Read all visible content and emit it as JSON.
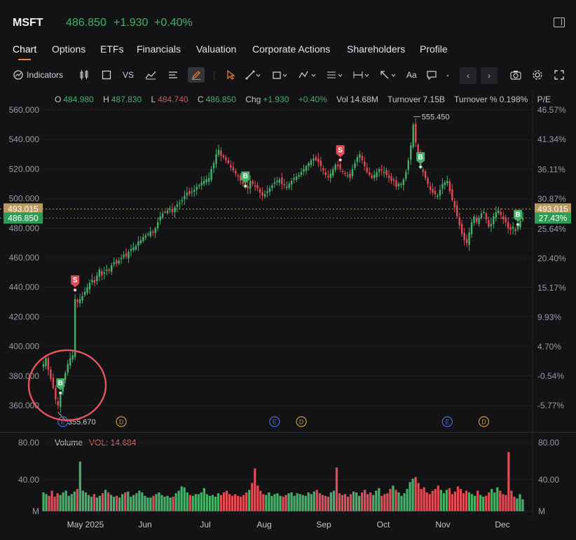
{
  "header": {
    "symbol": "MSFT",
    "price": "486.850",
    "change": "+1.930",
    "change_pct": "+0.40%"
  },
  "tabs": [
    "Chart",
    "Options",
    "ETFs",
    "Financials",
    "Valuation",
    "Corporate Actions",
    "Shareholders",
    "Profile"
  ],
  "toolbar": {
    "indicators_label": "Indicators",
    "vs_label": "VS",
    "aa_label": "Aa"
  },
  "ohlc": {
    "o_label": "O",
    "o": "484.980",
    "h_label": "H",
    "h": "487.830",
    "l_label": "L",
    "l": "484.740",
    "c_label": "C",
    "c": "486.850",
    "chg_label": "Chg",
    "chg": "+1.930",
    "chg_pct": "+0.40%",
    "vol_label": "Vol",
    "vol": "14.68M",
    "turnover_label": "Turnover",
    "turnover": "7.15B",
    "turnover_pct_label": "Turnover %",
    "turnover_pct": "0.198%",
    "pe_label": "P/E"
  },
  "colors": {
    "up": "#46b069",
    "down": "#e04c56",
    "bg": "#131316",
    "accent": "#f07e3a",
    "badge_ref": "#b79a5e",
    "badge_last": "#2f9a55"
  },
  "chart_data": {
    "type": "candlestick",
    "y_ticks": [
      "560.000",
      "540.000",
      "520.000",
      "500.000",
      "480.000",
      "460.000",
      "440.000",
      "420.000",
      "400.000",
      "380.000",
      "360.000"
    ],
    "y_right_ticks": [
      "46.57%",
      "41.34%",
      "36.11%",
      "30.87%",
      "27.43%",
      "25.64%",
      "20.40%",
      "15.17%",
      "9.93%",
      "4.70%",
      "-0.54%",
      "-5.77%"
    ],
    "ylim": [
      347,
      562
    ],
    "x_labels": [
      "May 2025",
      "Jun",
      "Jul",
      "Aug",
      "Sep",
      "Oct",
      "Nov",
      "Dec"
    ],
    "ref_price": "493.015",
    "ref_pct": "493.015",
    "last_price": "486.850",
    "last_pct": "27.43%",
    "annotations": {
      "high": "555.450",
      "low": "355.670"
    },
    "close": [
      388,
      392,
      384,
      378,
      372,
      364,
      360,
      368,
      376,
      382,
      388,
      392,
      394,
      432,
      430,
      432,
      434,
      437,
      440,
      443,
      445,
      443,
      448,
      452,
      448,
      450,
      452,
      451,
      455,
      457,
      456,
      458,
      460,
      462,
      461,
      464,
      466,
      467,
      468,
      471,
      472,
      474,
      475,
      476,
      478,
      477,
      480,
      484,
      488,
      490,
      491,
      492,
      493,
      491,
      494,
      496,
      497,
      499,
      502,
      504,
      503,
      505,
      506,
      508,
      509,
      511,
      512,
      513,
      514,
      520,
      524,
      530,
      533,
      529,
      528,
      526,
      524,
      521,
      519,
      517,
      515,
      512,
      510,
      508,
      507,
      512,
      510,
      508,
      507,
      504,
      502,
      503,
      505,
      507,
      509,
      511,
      512,
      513,
      510,
      509,
      508,
      510,
      512,
      514,
      515,
      516,
      518,
      520,
      522,
      524,
      526,
      527,
      526,
      525,
      522,
      519,
      516,
      515,
      517,
      520,
      523,
      522,
      520,
      518,
      517,
      516,
      514,
      520,
      524,
      528,
      530,
      526,
      522,
      518,
      516,
      514,
      516,
      518,
      520,
      519,
      518,
      516,
      514,
      512,
      512,
      508,
      510,
      510,
      513,
      518,
      526,
      536,
      550,
      538,
      530,
      521,
      518,
      514,
      510,
      506,
      504,
      503,
      502,
      506,
      510,
      511,
      512,
      505,
      499,
      494,
      488,
      482,
      476,
      472,
      470,
      477,
      484,
      488,
      484,
      487,
      490,
      491,
      486,
      481,
      483,
      488,
      491,
      492,
      489,
      486,
      484,
      480,
      479,
      481,
      478,
      482,
      485,
      487
    ],
    "markers": [
      {
        "type": "B",
        "at": 7
      },
      {
        "type": "S",
        "at": 13
      },
      {
        "type": "B",
        "at": 83
      },
      {
        "type": "S",
        "at": 122
      },
      {
        "type": "B",
        "at": 155
      },
      {
        "type": "B",
        "at": 195
      }
    ],
    "events": [
      {
        "label": "E",
        "at": 8
      },
      {
        "label": "D",
        "at": 32
      },
      {
        "label": "E",
        "at": 95
      },
      {
        "label": "D",
        "at": 106
      },
      {
        "label": "E",
        "at": 166
      },
      {
        "label": "D",
        "at": 181
      }
    ],
    "volume": {
      "label": "Volume",
      "value_label": "VOL: 14.684",
      "ylim": [
        0,
        80
      ],
      "y_ticks": [
        "80.00",
        "40.00",
        "M"
      ],
      "y_right_ticks": [
        "80.00",
        "40.00",
        "M"
      ],
      "values": [
        22,
        20,
        18,
        24,
        17,
        21,
        19,
        22,
        24,
        18,
        20,
        23,
        26,
        58,
        24,
        22,
        19,
        17,
        20,
        16,
        18,
        21,
        25,
        22,
        19,
        17,
        18,
        16,
        20,
        22,
        23,
        17,
        19,
        21,
        24,
        22,
        18,
        16,
        16,
        18,
        20,
        22,
        19,
        17,
        18,
        16,
        17,
        21,
        24,
        29,
        28,
        22,
        19,
        18,
        20,
        20,
        22,
        27,
        20,
        18,
        19,
        17,
        21,
        19,
        22,
        24,
        20,
        18,
        20,
        18,
        17,
        19,
        22,
        25,
        33,
        50,
        30,
        24,
        20,
        19,
        22,
        18,
        20,
        21,
        18,
        17,
        19,
        21,
        22,
        18,
        21,
        20,
        19,
        18,
        22,
        20,
        23,
        25,
        21,
        19,
        18,
        17,
        22,
        24,
        51,
        21,
        19,
        20,
        17,
        20,
        23,
        22,
        18,
        22,
        25,
        20,
        22,
        19,
        24,
        27,
        18,
        20,
        21,
        26,
        30,
        25,
        22,
        18,
        21,
        26,
        34,
        38,
        40,
        33,
        26,
        28,
        22,
        20,
        24,
        26,
        30,
        25,
        21,
        25,
        27,
        20,
        23,
        29,
        26,
        21,
        24,
        22,
        20,
        18,
        24,
        19,
        17,
        18,
        22,
        26,
        22,
        28,
        24,
        20,
        19,
        69,
        24,
        17,
        15,
        20,
        14
      ]
    }
  }
}
